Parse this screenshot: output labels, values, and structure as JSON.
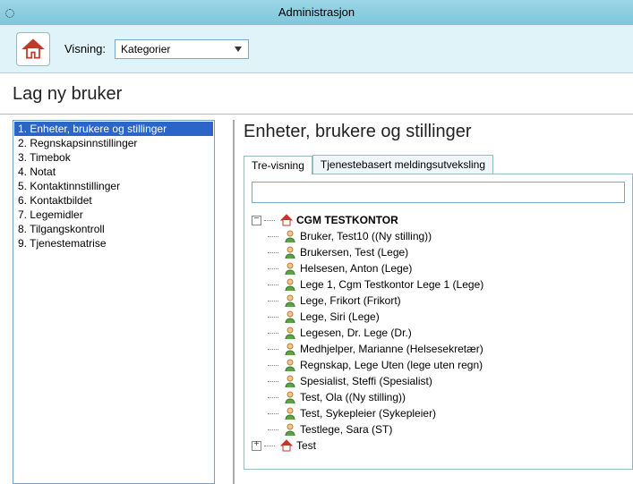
{
  "window": {
    "title": "Administrasjon"
  },
  "toolbar": {
    "visning_label": "Visning:",
    "visning_value": "Kategorier"
  },
  "subheader": "Lag ny bruker",
  "left_list": [
    "1. Enheter, brukere og stillinger",
    "2. Regnskapsinnstillinger",
    "3. Timebok",
    "4. Notat",
    "5. Kontaktinnstillinger",
    "6. Kontaktbildet",
    "7. Legemidler",
    "8. Tilgangskontroll",
    "9. Tjenestematrise"
  ],
  "selected_index": 0,
  "right": {
    "title": "Enheter, brukere og stillinger",
    "tabs": [
      "Tre-visning",
      "Tjenestebasert meldingsutveksling"
    ],
    "active_tab": 0,
    "root_name": "CGM TESTKONTOR",
    "users": [
      "Bruker, Test10 ((Ny stilling))",
      "Brukersen, Test (Lege)",
      "Helsesen, Anton (Lege)",
      "Lege 1, Cgm Testkontor Lege 1 (Lege)",
      "Lege, Frikort (Frikort)",
      "Lege, Siri (Lege)",
      "Legesen, Dr. Lege (Dr.)",
      "Medhjelper, Marianne (Helsesekretær)",
      "Regnskap, Lege Uten (lege uten regn)",
      "Spesialist, Steffi (Spesialist)",
      "Test, Ola ((Ny stilling))",
      "Test, Sykepleier (Sykepleier)",
      "Testlege, Sara (ST)"
    ],
    "second_root": "Test"
  }
}
